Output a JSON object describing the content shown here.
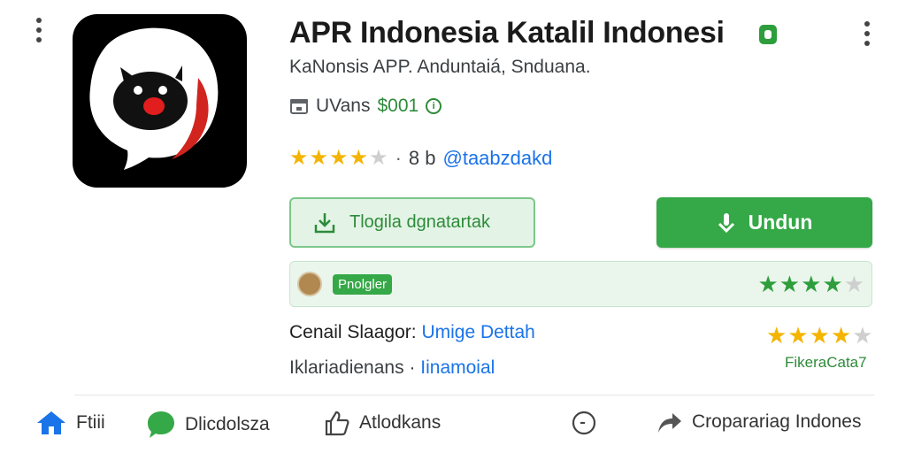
{
  "app": {
    "title": "APR Indonesia Katalil Indonesi",
    "subtitle": "KaNonsis APP. Anduntaiá, Snduana.",
    "price_label": "UVans",
    "price": "$001",
    "rating_stars": 4.5,
    "rating_separator": "·",
    "rating_count": "8 b",
    "rating_handle": "@taabzdakd"
  },
  "buttons": {
    "secondary_label": "Tlogila dgnatartak",
    "primary_label": "Undun"
  },
  "review_bar": {
    "tag_label": "Pnolgler",
    "stars": 3.5
  },
  "details": {
    "developer_key": "Cenail Slaagor:",
    "developer_value": "Umige Dettah",
    "category_key": "Iklariadienans",
    "category_separator": "·",
    "category_value": "Iinamoial"
  },
  "side_rating": {
    "stars": 4,
    "label": "FikeraCata7"
  },
  "bottom_nav": {
    "home": "Ftiii",
    "chat": "Dlicdolsza",
    "like": "Atlodkans",
    "share": "Croparariag Indones"
  },
  "colors": {
    "accent_green": "#35a847",
    "link_blue": "#1a73e8",
    "star_yellow": "#f4b400"
  }
}
